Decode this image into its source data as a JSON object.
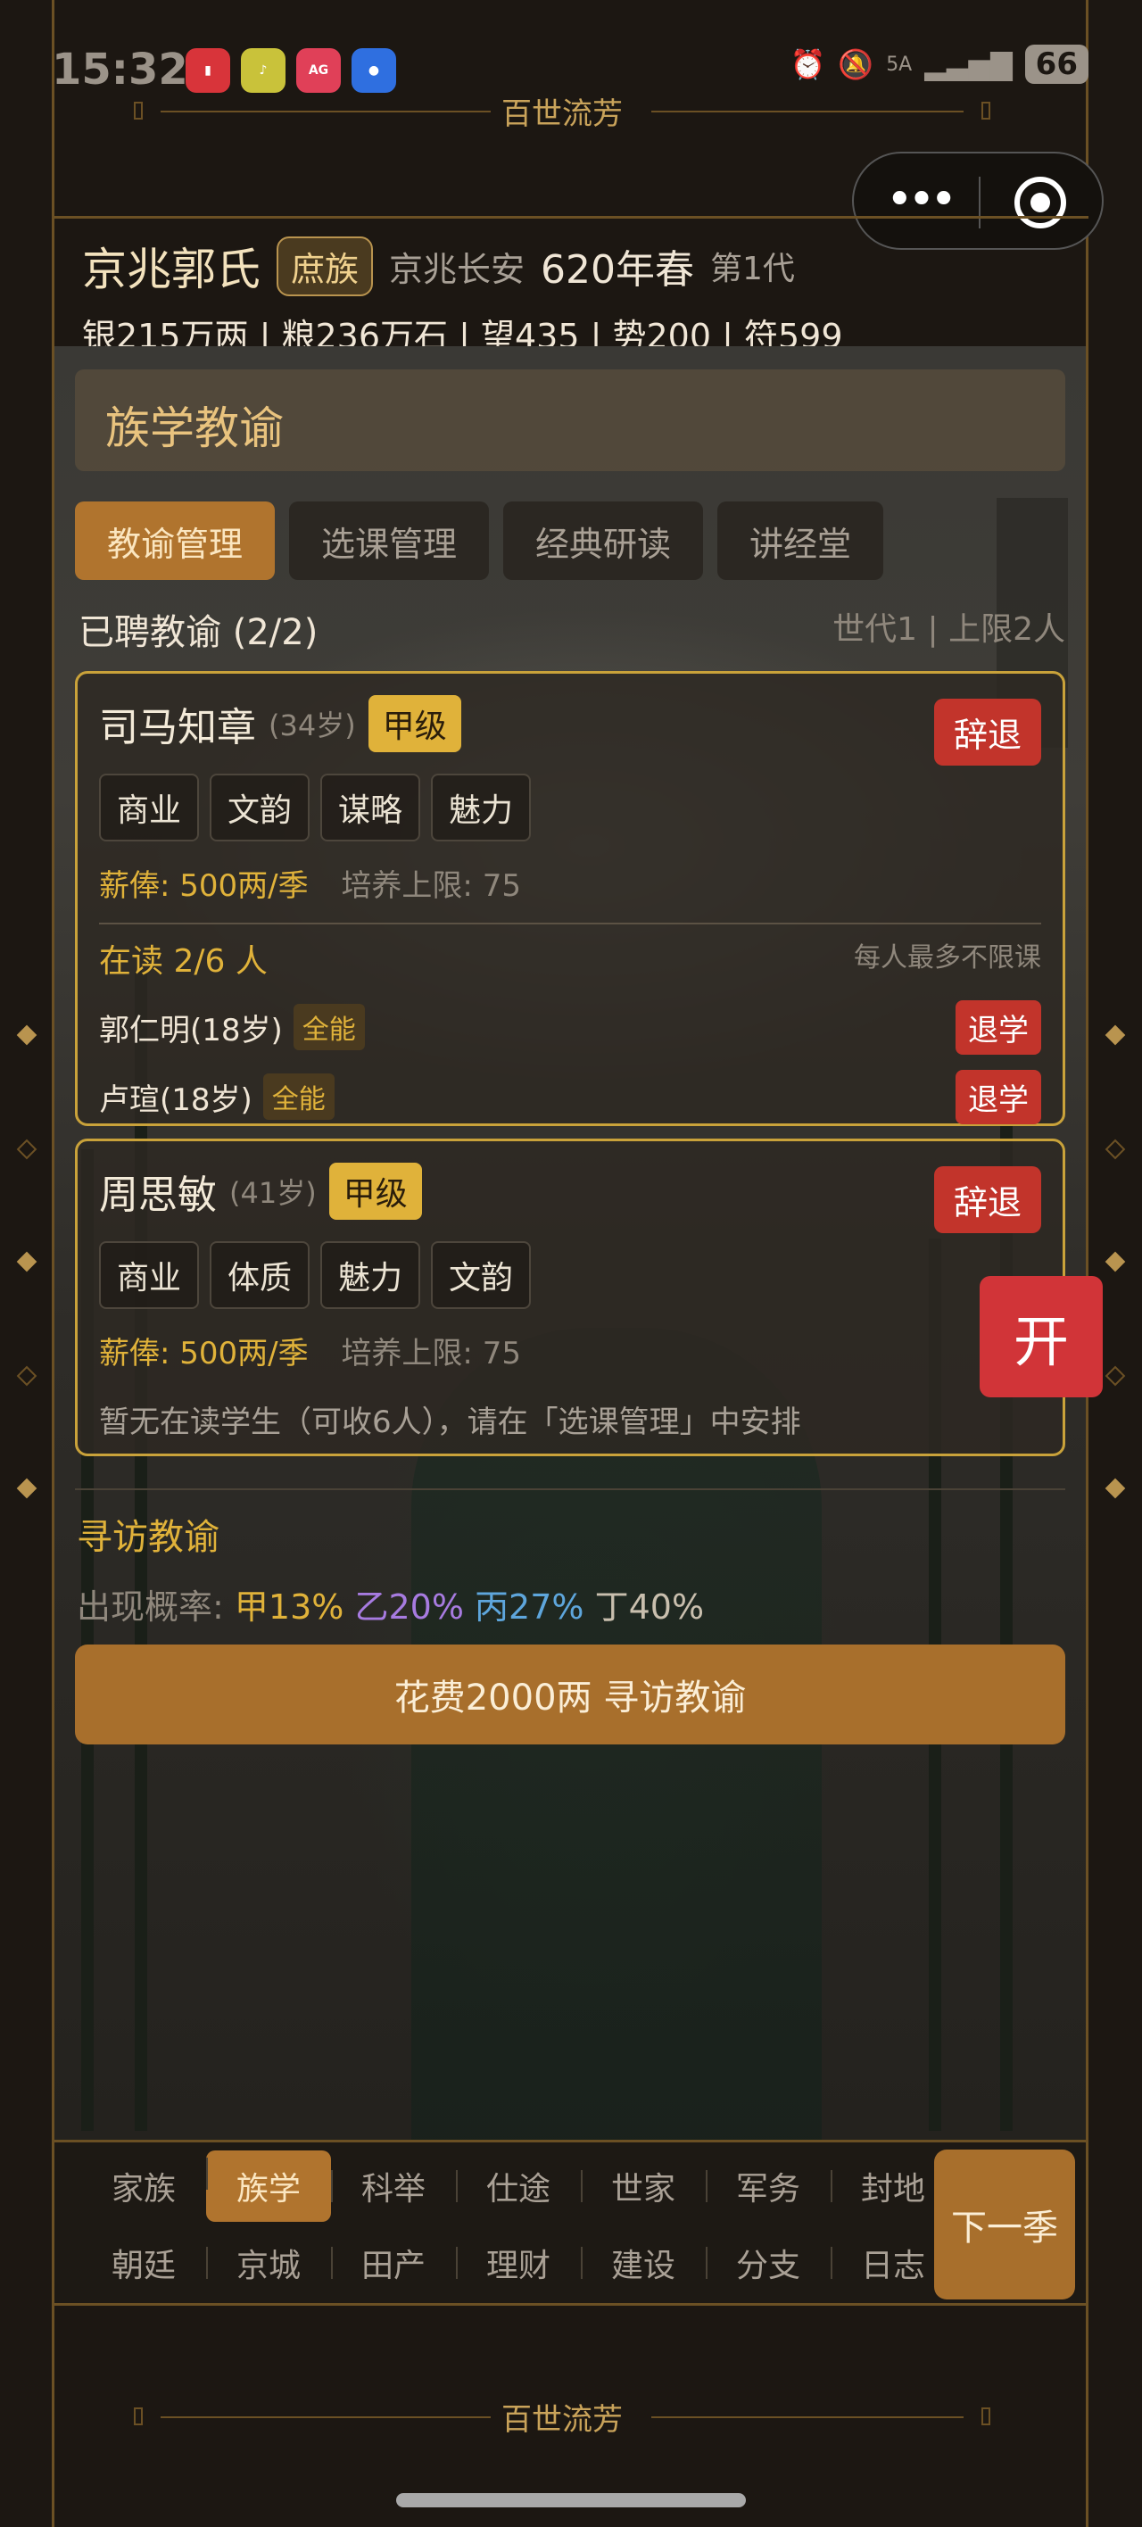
{
  "status": {
    "time": "15:32",
    "network": "5A",
    "battery": "66"
  },
  "ornament_title": "百世流芳",
  "family": {
    "name": "京兆郭氏",
    "rank_badge": "庶族",
    "location": "京兆长安",
    "year": "620年春",
    "generation": "第1代",
    "resources": "银215万两 | 粮236万石 | 望435 | 势200 | 符599"
  },
  "panel": {
    "title": "族学教谕",
    "tabs": [
      "教谕管理",
      "选课管理",
      "经典研读",
      "讲经堂"
    ],
    "hired_label": "已聘教谕 (2/2)",
    "hired_limit": "世代1 | 上限2人"
  },
  "teachers": [
    {
      "name": "司马知章",
      "age": "(34岁)",
      "grade": "甲级",
      "dismiss": "辞退",
      "skills": [
        "商业",
        "文韵",
        "谋略",
        "魅力"
      ],
      "salary": "薪俸: 500两/季",
      "train_cap": "培养上限: 75",
      "reading": "在读 2/6 人",
      "reading_note": "每人最多不限课",
      "students": [
        {
          "name": "郭仁明(18岁)",
          "tag": "全能",
          "action": "退学"
        },
        {
          "name": "卢瑄(18岁)",
          "tag": "全能",
          "action": "退学"
        }
      ]
    },
    {
      "name": "周思敏",
      "age": "(41岁)",
      "grade": "甲级",
      "dismiss": "辞退",
      "skills": [
        "商业",
        "体质",
        "魅力",
        "文韵"
      ],
      "salary": "薪俸: 500两/季",
      "train_cap": "培养上限: 75",
      "empty_note": "暂无在读学生（可收6人），请在「选课管理」中安排"
    }
  ],
  "float_button": "开",
  "seek": {
    "title": "寻访教谕",
    "prob_label": "出现概率:",
    "prob_a": "甲13%",
    "prob_b": "乙20%",
    "prob_c": "丙27%",
    "prob_d": "丁40%",
    "button": "花费2000两 寻访教谕"
  },
  "nav": {
    "row1": [
      "家族",
      "族学",
      "科举",
      "仕途",
      "世家",
      "军务",
      "封地"
    ],
    "row2": [
      "朝廷",
      "京城",
      "田产",
      "理财",
      "建设",
      "分支",
      "日志"
    ],
    "active": "族学",
    "next": "下一季"
  }
}
